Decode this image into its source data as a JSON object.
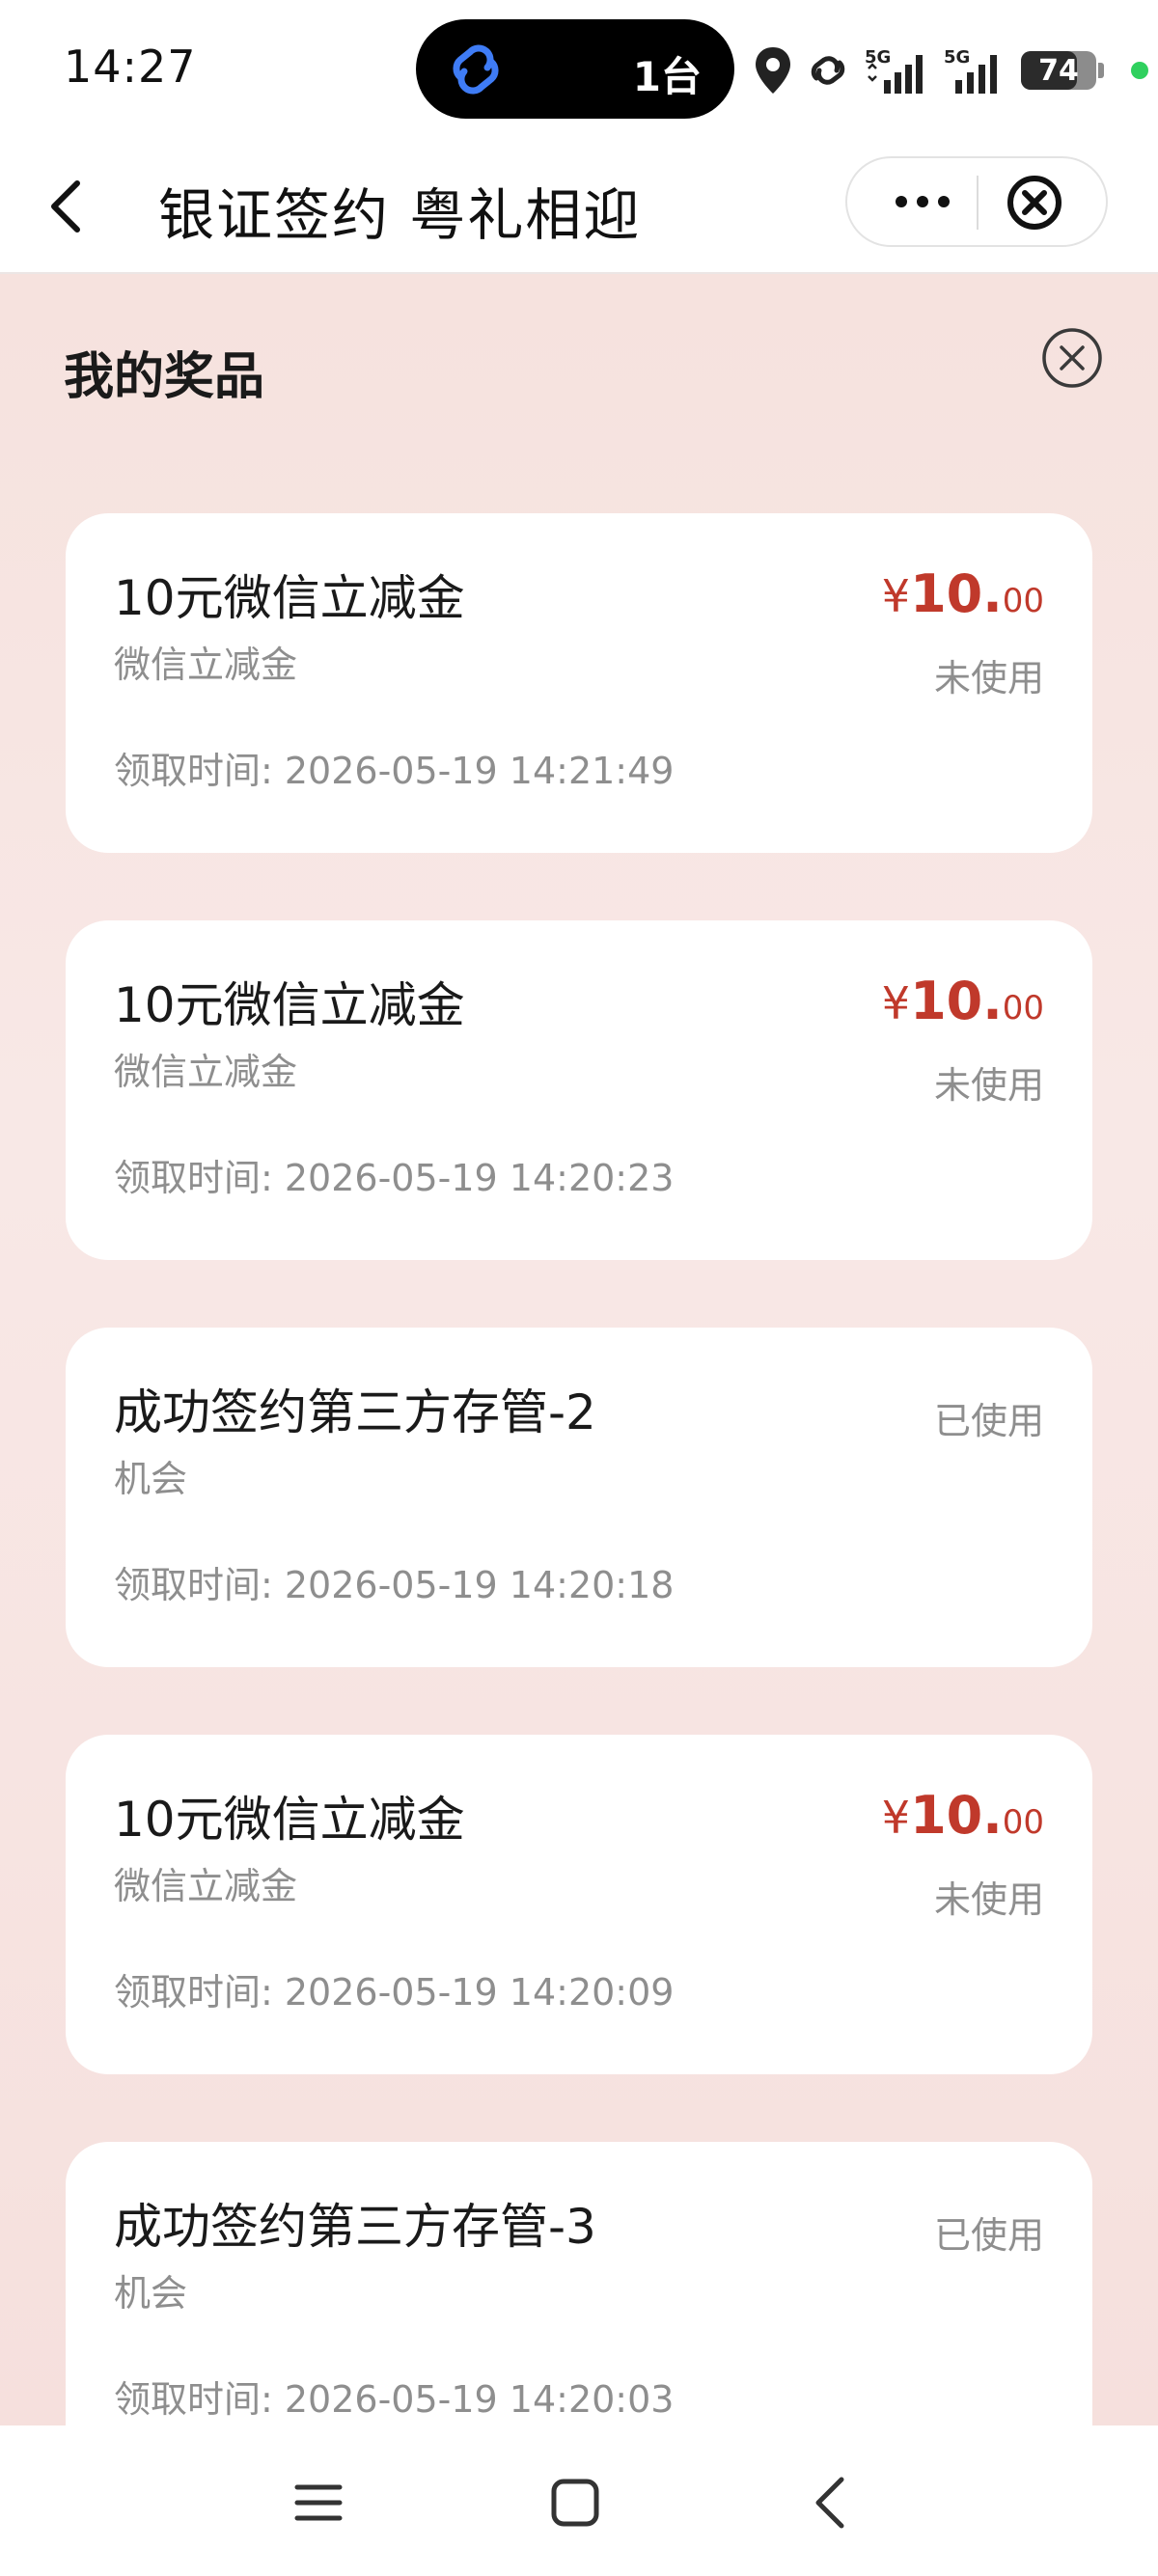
{
  "status_bar": {
    "time": "14:27",
    "island_text": "1台",
    "battery_level": "74",
    "battery_fraction": 0.74,
    "network_labels": [
      "5G",
      "5G"
    ]
  },
  "nav": {
    "title": "银证签约 粤礼相迎"
  },
  "panel": {
    "title": "我的奖品"
  },
  "prizes": [
    {
      "name": "10元微信立减金",
      "type": "微信立减金",
      "time": "领取时间: 2026-05-19 14:21:49",
      "amount_symbol": "¥",
      "amount_int": "10.",
      "amount_dec": "00",
      "status": "未使用"
    },
    {
      "name": "10元微信立减金",
      "type": "微信立减金",
      "time": "领取时间: 2026-05-19 14:20:23",
      "amount_symbol": "¥",
      "amount_int": "10.",
      "amount_dec": "00",
      "status": "未使用"
    },
    {
      "name": "成功签约第三方存管-2",
      "type": "机会",
      "time": "领取时间: 2026-05-19 14:20:18",
      "status": "已使用"
    },
    {
      "name": "10元微信立减金",
      "type": "微信立减金",
      "time": "领取时间: 2026-05-19 14:20:09",
      "amount_symbol": "¥",
      "amount_int": "10.",
      "amount_dec": "00",
      "status": "未使用"
    },
    {
      "name": "成功签约第三方存管-3",
      "type": "机会",
      "time": "领取时间: 2026-05-19 14:20:03",
      "status": "已使用"
    }
  ],
  "colors": {
    "accent": "#c0392b",
    "background": "#f6e5e2",
    "card": "#ffffff",
    "muted_text": "#8e8e8e"
  }
}
